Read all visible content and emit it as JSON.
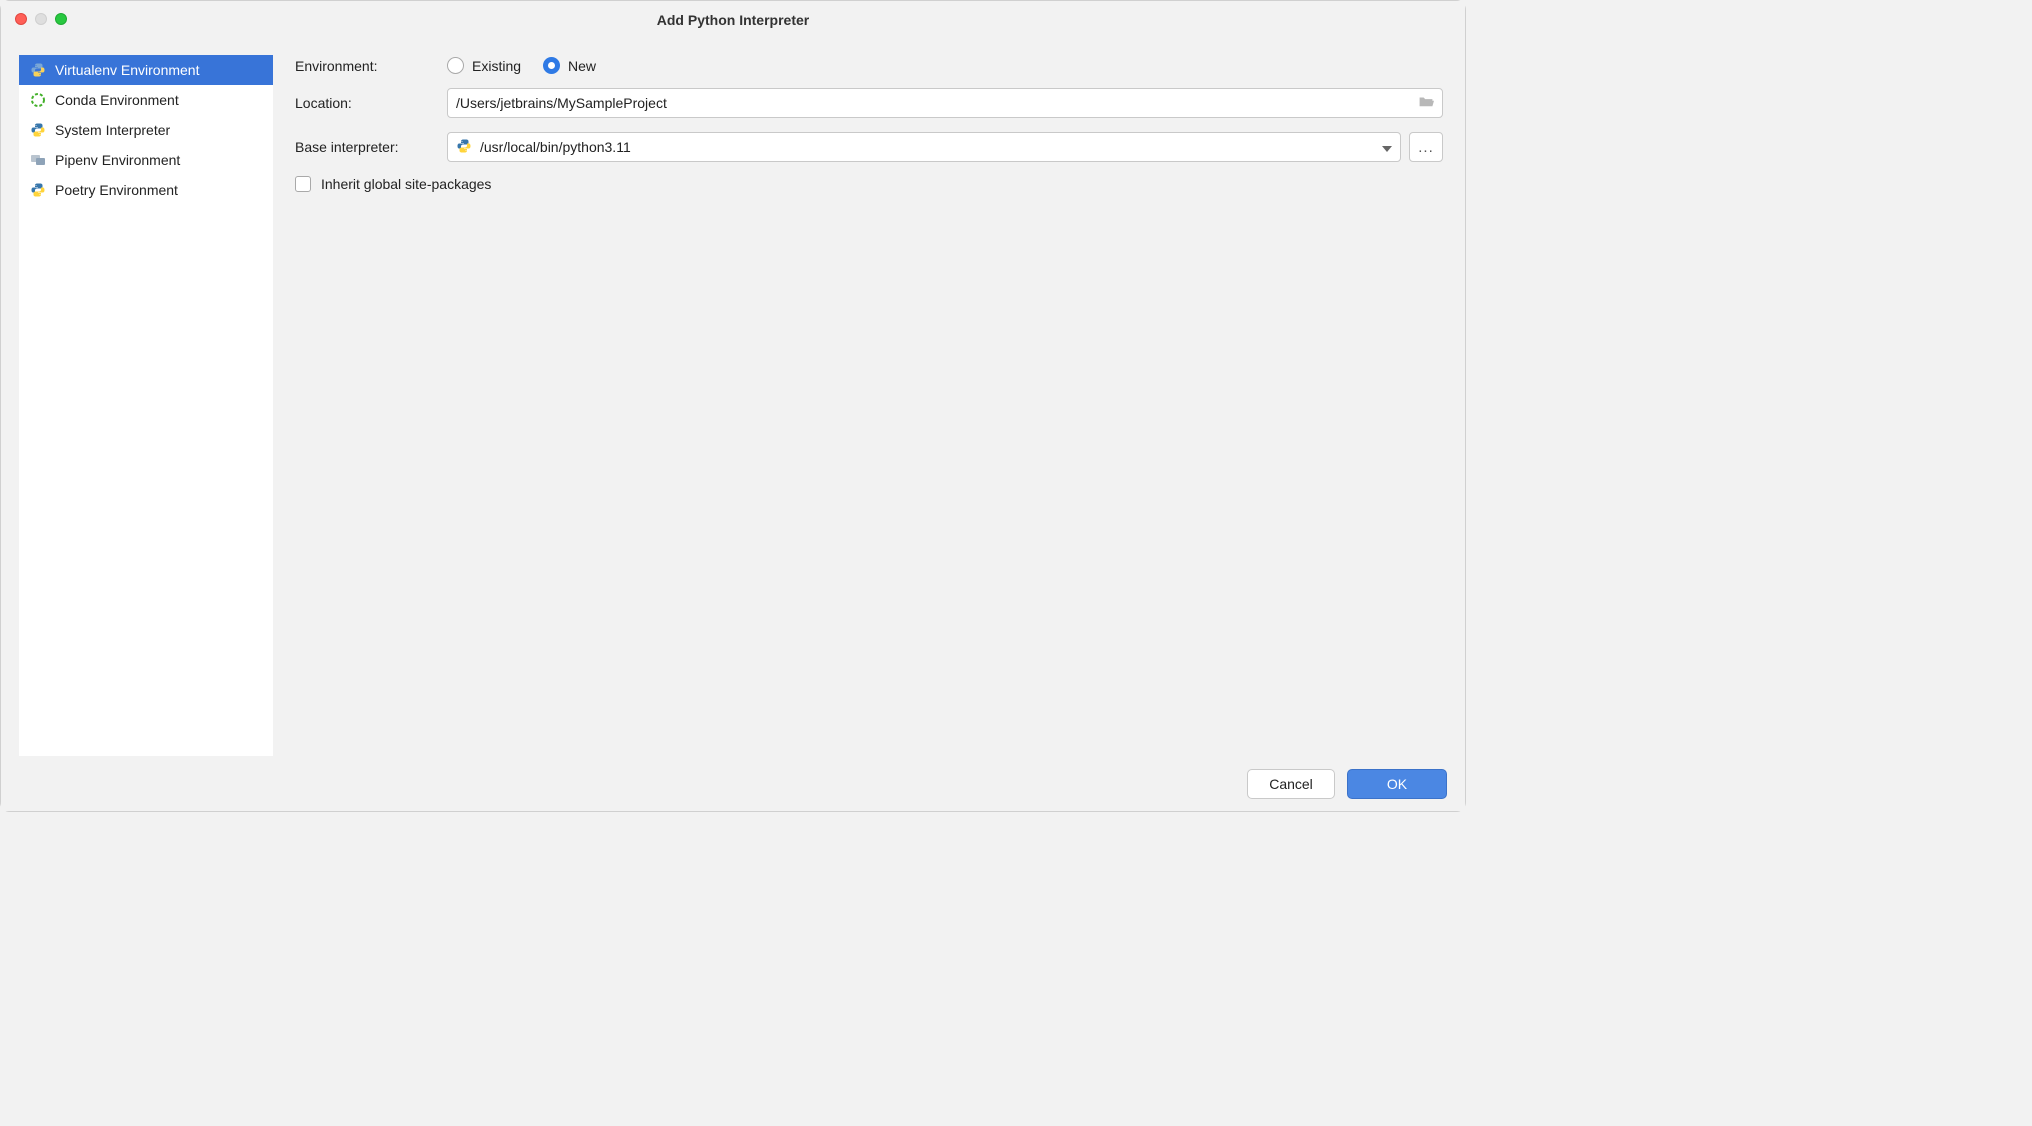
{
  "window": {
    "title": "Add Python Interpreter"
  },
  "sidebar": {
    "items": [
      {
        "label": "Virtualenv Environment",
        "selected": true,
        "icon": "python"
      },
      {
        "label": "Conda Environment",
        "selected": false,
        "icon": "conda"
      },
      {
        "label": "System Interpreter",
        "selected": false,
        "icon": "python"
      },
      {
        "label": "Pipenv Environment",
        "selected": false,
        "icon": "pipenv"
      },
      {
        "label": "Poetry Environment",
        "selected": false,
        "icon": "python"
      }
    ]
  },
  "form": {
    "environment": {
      "label": "Environment:",
      "options": [
        {
          "label": "Existing",
          "selected": false
        },
        {
          "label": "New",
          "selected": true
        }
      ]
    },
    "location": {
      "label": "Location:",
      "value": "/Users/jetbrains/MySampleProject"
    },
    "base_interpreter": {
      "label": "Base interpreter:",
      "value": "/usr/local/bin/python3.11",
      "browse_label": "..."
    },
    "inherit": {
      "label": "Inherit global site-packages",
      "checked": false
    }
  },
  "footer": {
    "cancel": "Cancel",
    "ok": "OK"
  }
}
